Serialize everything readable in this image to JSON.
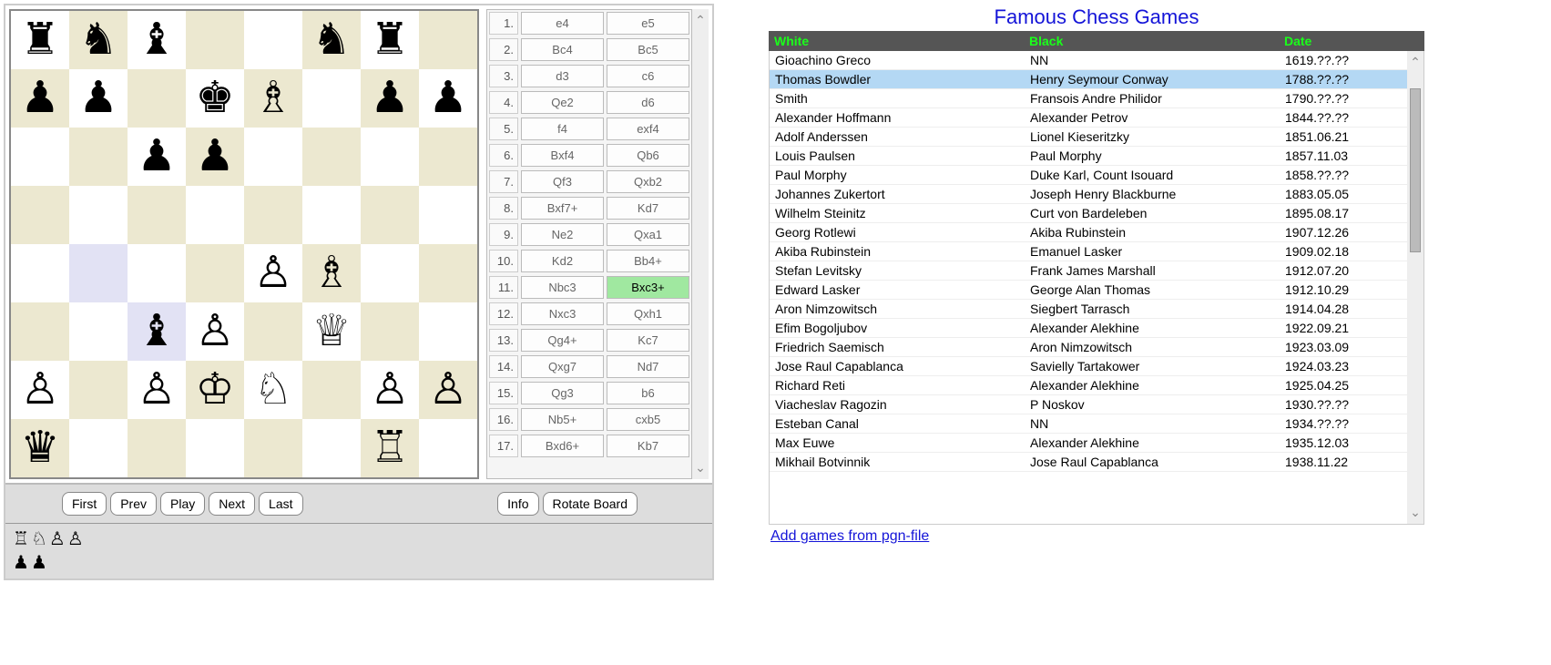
{
  "board": {
    "rows": [
      [
        "♜",
        "♞",
        "♝",
        "",
        "",
        "♞",
        "♜",
        ""
      ],
      [
        "♟",
        "♟",
        "",
        "♚",
        "♗",
        "",
        "♟",
        "♟"
      ],
      [
        "",
        "",
        "♟",
        "♟",
        "",
        "",
        "",
        ""
      ],
      [
        "",
        "",
        "",
        "",
        "",
        "",
        "",
        ""
      ],
      [
        "",
        "",
        "",
        "",
        "♙",
        "♗",
        "",
        ""
      ],
      [
        "",
        "",
        "♝",
        "♙",
        "",
        "♕",
        "",
        ""
      ],
      [
        "♙",
        "",
        "♙",
        "♔",
        "♘",
        "",
        "♙",
        "♙"
      ],
      [
        "♛",
        "",
        "",
        "",
        "",
        "",
        "♖",
        ""
      ]
    ],
    "highlights": [
      [
        4,
        1
      ],
      [
        5,
        2
      ]
    ]
  },
  "moves": [
    {
      "n": "1.",
      "w": "e4",
      "b": "e5"
    },
    {
      "n": "2.",
      "w": "Bc4",
      "b": "Bc5"
    },
    {
      "n": "3.",
      "w": "d3",
      "b": "c6"
    },
    {
      "n": "4.",
      "w": "Qe2",
      "b": "d6"
    },
    {
      "n": "5.",
      "w": "f4",
      "b": "exf4"
    },
    {
      "n": "6.",
      "w": "Bxf4",
      "b": "Qb6"
    },
    {
      "n": "7.",
      "w": "Qf3",
      "b": "Qxb2"
    },
    {
      "n": "8.",
      "w": "Bxf7+",
      "b": "Kd7"
    },
    {
      "n": "9.",
      "w": "Ne2",
      "b": "Qxa1"
    },
    {
      "n": "10.",
      "w": "Kd2",
      "b": "Bb4+"
    },
    {
      "n": "11.",
      "w": "Nbc3",
      "b": "Bxc3+"
    },
    {
      "n": "12.",
      "w": "Nxc3",
      "b": "Qxh1"
    },
    {
      "n": "13.",
      "w": "Qg4+",
      "b": "Kc7"
    },
    {
      "n": "14.",
      "w": "Qxg7",
      "b": "Nd7"
    },
    {
      "n": "15.",
      "w": "Qg3",
      "b": "b6"
    },
    {
      "n": "16.",
      "w": "Nb5+",
      "b": "cxb5"
    },
    {
      "n": "17.",
      "w": "Bxd6+",
      "b": "Kb7"
    }
  ],
  "current_move": {
    "row": 10,
    "side": "b"
  },
  "controls": {
    "first": "First",
    "prev": "Prev",
    "play": "Play",
    "next": "Next",
    "last": "Last",
    "info": "Info",
    "rotate": "Rotate Board"
  },
  "captured": {
    "white": [
      "♖",
      "♘",
      "♙",
      "♙"
    ],
    "black": [
      "♟",
      "♟"
    ]
  },
  "games_title": "Famous Chess Games",
  "games_headers": {
    "white": "White",
    "black": "Black",
    "date": "Date"
  },
  "games": [
    {
      "w": "Gioachino Greco",
      "b": "NN",
      "d": "1619.??.??"
    },
    {
      "w": "Thomas Bowdler",
      "b": "Henry Seymour Conway",
      "d": "1788.??.??"
    },
    {
      "w": "Smith",
      "b": "Fransois Andre Philidor",
      "d": "1790.??.??"
    },
    {
      "w": "Alexander Hoffmann",
      "b": "Alexander Petrov",
      "d": "1844.??.??"
    },
    {
      "w": "Adolf Anderssen",
      "b": "Lionel Kieseritzky",
      "d": "1851.06.21"
    },
    {
      "w": "Louis Paulsen",
      "b": "Paul Morphy",
      "d": "1857.11.03"
    },
    {
      "w": "Paul Morphy",
      "b": "Duke Karl, Count Isouard",
      "d": "1858.??.??"
    },
    {
      "w": "Johannes Zukertort",
      "b": "Joseph Henry Blackburne",
      "d": "1883.05.05"
    },
    {
      "w": "Wilhelm Steinitz",
      "b": "Curt von Bardeleben",
      "d": "1895.08.17"
    },
    {
      "w": "Georg Rotlewi",
      "b": "Akiba Rubinstein",
      "d": "1907.12.26"
    },
    {
      "w": "Akiba Rubinstein",
      "b": "Emanuel Lasker",
      "d": "1909.02.18"
    },
    {
      "w": "Stefan Levitsky",
      "b": "Frank James Marshall",
      "d": "1912.07.20"
    },
    {
      "w": "Edward Lasker",
      "b": "George Alan Thomas",
      "d": "1912.10.29"
    },
    {
      "w": "Aron Nimzowitsch",
      "b": "Siegbert Tarrasch",
      "d": "1914.04.28"
    },
    {
      "w": "Efim Bogoljubov",
      "b": "Alexander Alekhine",
      "d": "1922.09.21"
    },
    {
      "w": "Friedrich Saemisch",
      "b": "Aron Nimzowitsch",
      "d": "1923.03.09"
    },
    {
      "w": "Jose Raul Capablanca",
      "b": "Savielly Tartakower",
      "d": "1924.03.23"
    },
    {
      "w": "Richard Reti",
      "b": "Alexander Alekhine",
      "d": "1925.04.25"
    },
    {
      "w": "Viacheslav Ragozin",
      "b": "P Noskov",
      "d": "1930.??.??"
    },
    {
      "w": "Esteban Canal",
      "b": "NN",
      "d": "1934.??.??"
    },
    {
      "w": "Max Euwe",
      "b": "Alexander Alekhine",
      "d": "1935.12.03"
    },
    {
      "w": "Mikhail Botvinnik",
      "b": "Jose Raul Capablanca",
      "d": "1938.11.22"
    }
  ],
  "selected_game": 1,
  "add_link": "Add games from pgn-file"
}
